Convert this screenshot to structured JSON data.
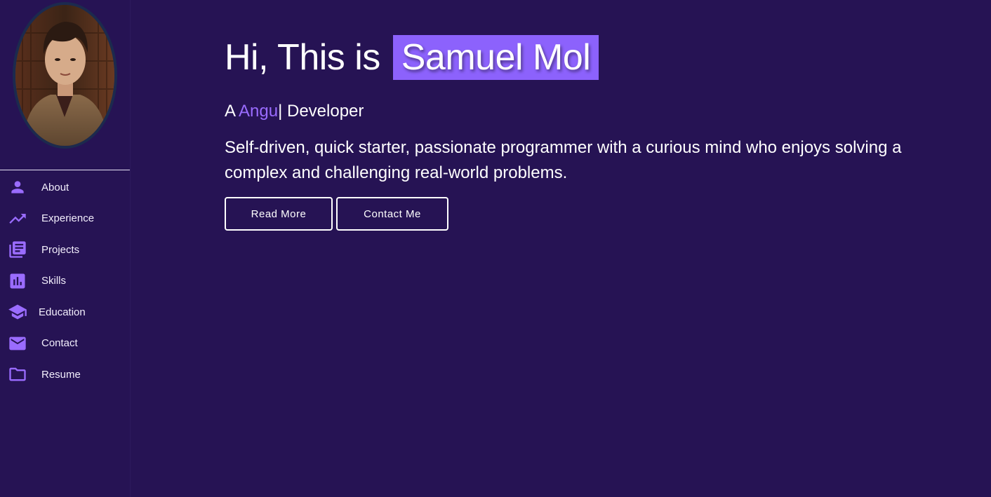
{
  "profile": {
    "name": "Samuel Mol"
  },
  "hero": {
    "greeting": "Hi, This is",
    "name": "Samuel Mol",
    "subtitle_prefix": "A ",
    "typed_text": "Angu",
    "cursor": "|",
    "subtitle_suffix": " Developer",
    "description": "Self-driven, quick starter, passionate programmer with a curious mind who enjoys solving a complex and challenging real-world problems.",
    "buttons": {
      "read_more": "Read More",
      "contact_me": "Contact Me"
    }
  },
  "sidebar": {
    "items": [
      {
        "label": "About",
        "icon": "person-icon"
      },
      {
        "label": "Experience",
        "icon": "trending-up-icon"
      },
      {
        "label": "Projects",
        "icon": "library-books-icon"
      },
      {
        "label": "Skills",
        "icon": "bar-chart-icon"
      },
      {
        "label": "Education",
        "icon": "school-icon"
      },
      {
        "label": "Contact",
        "icon": "mail-icon"
      },
      {
        "label": "Resume",
        "icon": "folder-icon"
      }
    ]
  },
  "colors": {
    "background": "#261354",
    "accent": "#8c62fc",
    "typed_text": "#9a6cff",
    "icon": "#9a6cff",
    "text": "#ffffff"
  }
}
